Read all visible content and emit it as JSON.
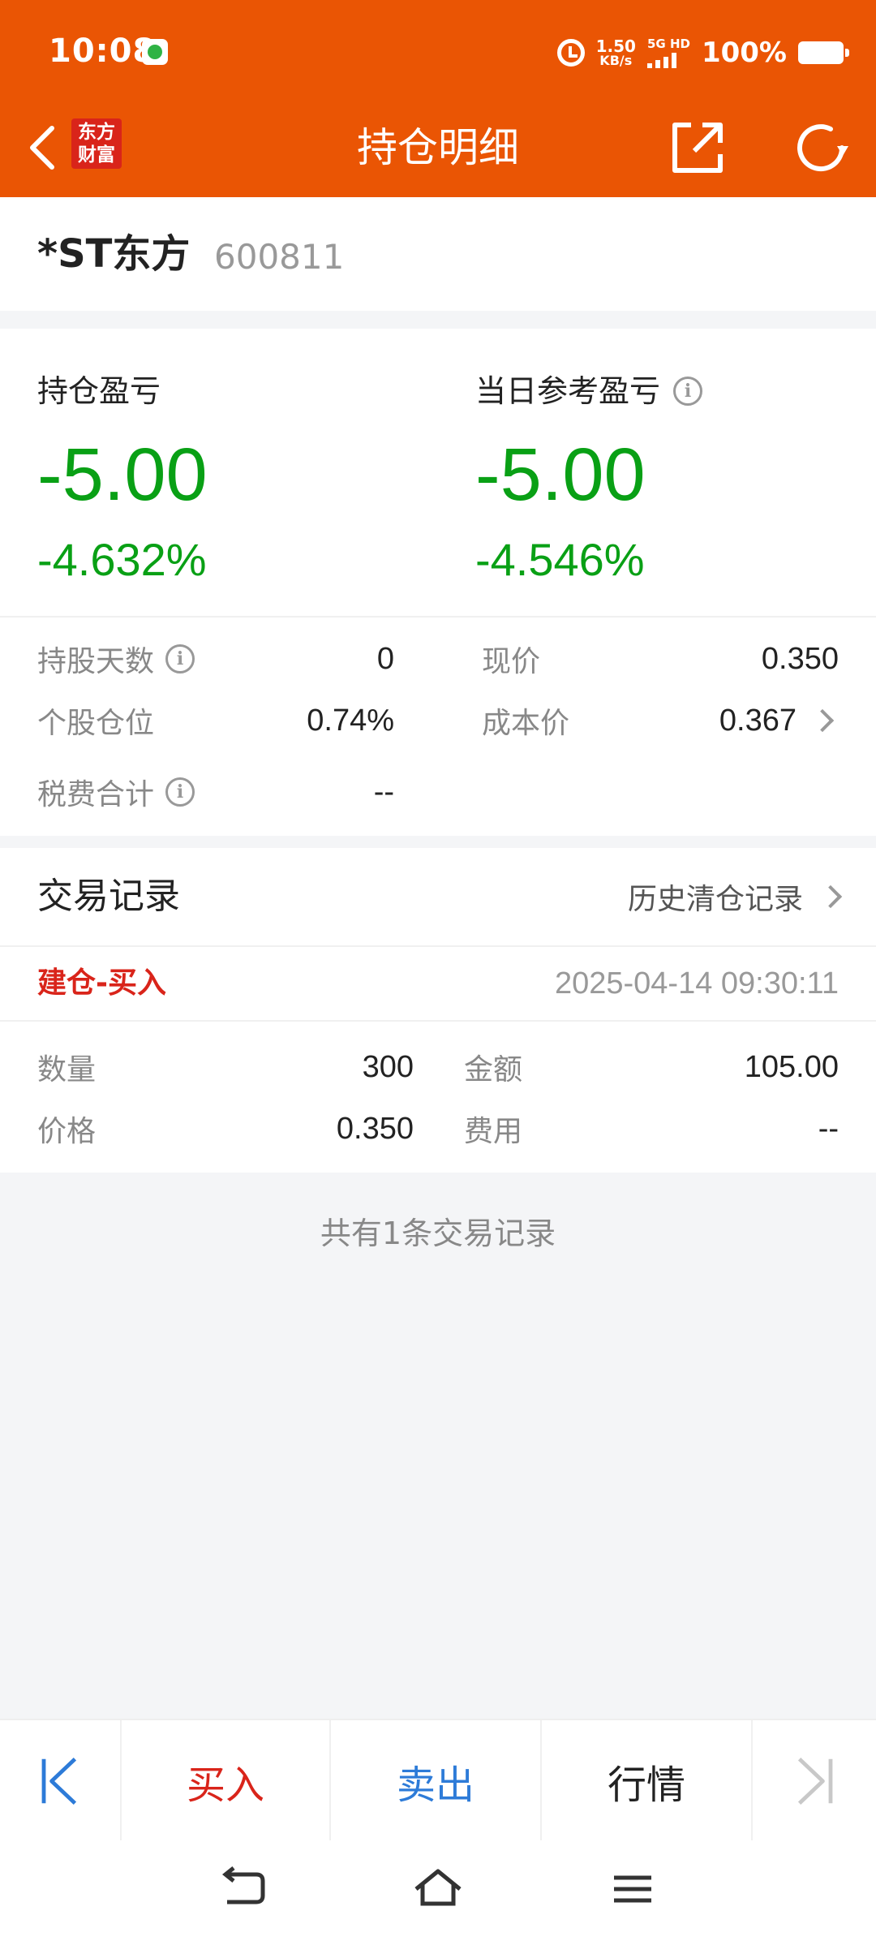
{
  "status_bar": {
    "time": "10:08",
    "net_speed_value": "1.50",
    "net_speed_unit": "KB/s",
    "network_label": "5G HD",
    "battery_percent": "100%"
  },
  "nav": {
    "title": "持仓明细",
    "brand_line1": "东方",
    "brand_line2": "财富"
  },
  "stock": {
    "name": "*ST东方",
    "code": "600811"
  },
  "profit": {
    "position_label": "持仓盈亏",
    "position_value": "-5.00",
    "position_pct": "-4.632%",
    "daily_label": "当日参考盈亏",
    "daily_value": "-5.00",
    "daily_pct": "-4.546%",
    "info_glyph": "i"
  },
  "stats": {
    "hold_days_label": "持股天数",
    "hold_days_value": "0",
    "current_price_label": "现价",
    "current_price_value": "0.350",
    "position_ratio_label": "个股仓位",
    "position_ratio_value": "0.74%",
    "cost_price_label": "成本价",
    "cost_price_value": "0.367",
    "tax_label": "税费合计",
    "tax_value": "--"
  },
  "trades": {
    "section_title": "交易记录",
    "history_link": "历史清仓记录",
    "records": [
      {
        "type": "建仓-买入",
        "time": "2025-04-14 09:30:11",
        "quantity_label": "数量",
        "quantity_value": "300",
        "amount_label": "金额",
        "amount_value": "105.00",
        "price_label": "价格",
        "price_value": "0.350",
        "fee_label": "费用",
        "fee_value": "--"
      }
    ],
    "count_text": "共有1条交易记录"
  },
  "actions": {
    "buy": "买入",
    "sell": "卖出",
    "quote": "行情"
  },
  "colors": {
    "brand_orange": "#ea5504",
    "loss_green": "#09a015",
    "buy_red": "#d9241a",
    "sell_blue": "#2d7bd8"
  }
}
